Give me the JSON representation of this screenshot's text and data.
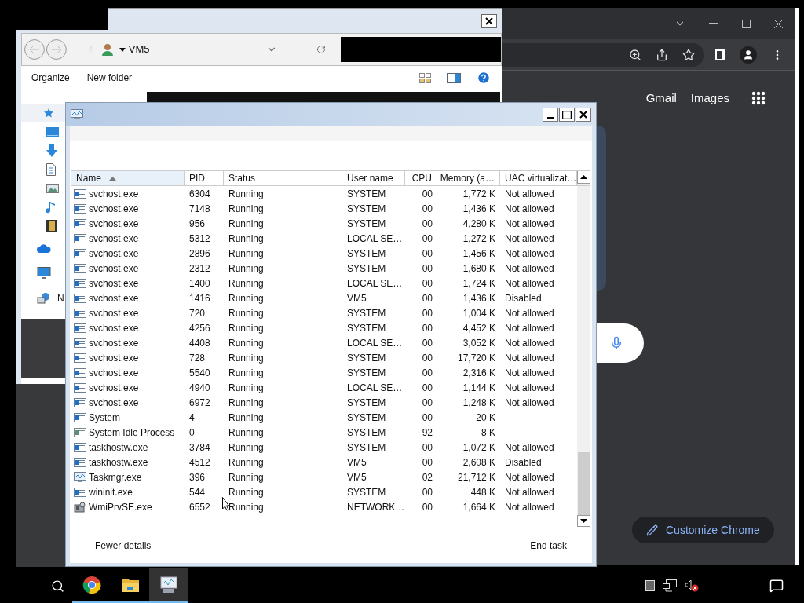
{
  "explorer": {
    "location": "VM5",
    "commands": [
      "Organize",
      "New folder"
    ],
    "nav_items": [
      {
        "kind": "star"
      },
      {
        "kind": "desktop"
      },
      {
        "kind": "download"
      },
      {
        "kind": "document"
      },
      {
        "kind": "pictures"
      },
      {
        "kind": "music"
      },
      {
        "kind": "videos"
      },
      {
        "kind": "cloud"
      },
      {
        "kind": "computer"
      },
      {
        "kind": "network",
        "label": "N"
      }
    ]
  },
  "chrome": {
    "links": [
      "Gmail",
      "Images"
    ],
    "customize_button": "Customize Chrome"
  },
  "task_manager": {
    "columns": [
      {
        "label": "Name",
        "sorted": true
      },
      {
        "label": "PID",
        "sorted": false
      },
      {
        "label": "Status",
        "sorted": false
      },
      {
        "label": "User name",
        "sorted": false
      },
      {
        "label": "CPU",
        "sorted": false
      },
      {
        "label": "Memory (a…",
        "sorted": false
      },
      {
        "label": "UAC virtualizat…",
        "sorted": false
      }
    ],
    "rows": [
      {
        "kind": "service",
        "name": "svchost.exe",
        "pid": "6304",
        "status": "Running",
        "user": "SYSTEM",
        "cpu": "00",
        "memory": "1,772 K",
        "uac": "Not allowed"
      },
      {
        "kind": "service",
        "name": "svchost.exe",
        "pid": "7148",
        "status": "Running",
        "user": "SYSTEM",
        "cpu": "00",
        "memory": "1,436 K",
        "uac": "Not allowed"
      },
      {
        "kind": "service",
        "name": "svchost.exe",
        "pid": "956",
        "status": "Running",
        "user": "SYSTEM",
        "cpu": "00",
        "memory": "4,280 K",
        "uac": "Not allowed"
      },
      {
        "kind": "service",
        "name": "svchost.exe",
        "pid": "5312",
        "status": "Running",
        "user": "LOCAL SE…",
        "cpu": "00",
        "memory": "1,272 K",
        "uac": "Not allowed"
      },
      {
        "kind": "service",
        "name": "svchost.exe",
        "pid": "2896",
        "status": "Running",
        "user": "SYSTEM",
        "cpu": "00",
        "memory": "1,456 K",
        "uac": "Not allowed"
      },
      {
        "kind": "service",
        "name": "svchost.exe",
        "pid": "2312",
        "status": "Running",
        "user": "SYSTEM",
        "cpu": "00",
        "memory": "1,680 K",
        "uac": "Not allowed"
      },
      {
        "kind": "service",
        "name": "svchost.exe",
        "pid": "1400",
        "status": "Running",
        "user": "LOCAL SE…",
        "cpu": "00",
        "memory": "1,724 K",
        "uac": "Not allowed"
      },
      {
        "kind": "service",
        "name": "svchost.exe",
        "pid": "1416",
        "status": "Running",
        "user": "VM5",
        "cpu": "00",
        "memory": "1,436 K",
        "uac": "Disabled"
      },
      {
        "kind": "service",
        "name": "svchost.exe",
        "pid": "720",
        "status": "Running",
        "user": "SYSTEM",
        "cpu": "00",
        "memory": "1,004 K",
        "uac": "Not allowed"
      },
      {
        "kind": "service",
        "name": "svchost.exe",
        "pid": "4256",
        "status": "Running",
        "user": "SYSTEM",
        "cpu": "00",
        "memory": "4,452 K",
        "uac": "Not allowed"
      },
      {
        "kind": "service",
        "name": "svchost.exe",
        "pid": "4408",
        "status": "Running",
        "user": "LOCAL SE…",
        "cpu": "00",
        "memory": "3,052 K",
        "uac": "Not allowed"
      },
      {
        "kind": "service",
        "name": "svchost.exe",
        "pid": "728",
        "status": "Running",
        "user": "SYSTEM",
        "cpu": "00",
        "memory": "17,720 K",
        "uac": "Not allowed"
      },
      {
        "kind": "service",
        "name": "svchost.exe",
        "pid": "5540",
        "status": "Running",
        "user": "SYSTEM",
        "cpu": "00",
        "memory": "2,316 K",
        "uac": "Not allowed"
      },
      {
        "kind": "service",
        "name": "svchost.exe",
        "pid": "4940",
        "status": "Running",
        "user": "LOCAL SE…",
        "cpu": "00",
        "memory": "1,144 K",
        "uac": "Not allowed"
      },
      {
        "kind": "service",
        "name": "svchost.exe",
        "pid": "6972",
        "status": "Running",
        "user": "SYSTEM",
        "cpu": "00",
        "memory": "1,248 K",
        "uac": "Not allowed"
      },
      {
        "kind": "service",
        "name": "System",
        "pid": "4",
        "status": "Running",
        "user": "SYSTEM",
        "cpu": "00",
        "memory": "20 K"
      },
      {
        "kind": "idle",
        "name": "System Idle Process",
        "pid": "0",
        "status": "Running",
        "user": "SYSTEM",
        "cpu": "92",
        "memory": "8 K"
      },
      {
        "kind": "service",
        "name": "taskhostw.exe",
        "pid": "3784",
        "status": "Running",
        "user": "SYSTEM",
        "cpu": "00",
        "memory": "1,072 K",
        "uac": "Not allowed"
      },
      {
        "kind": "service",
        "name": "taskhostw.exe",
        "pid": "4512",
        "status": "Running",
        "user": "VM5",
        "cpu": "00",
        "memory": "2,608 K",
        "uac": "Disabled"
      },
      {
        "kind": "monitor",
        "name": "Taskmgr.exe",
        "pid": "396",
        "status": "Running",
        "user": "VM5",
        "cpu": "02",
        "memory": "21,712 K",
        "uac": "Not allowed"
      },
      {
        "kind": "service",
        "name": "wininit.exe",
        "pid": "544",
        "status": "Running",
        "user": "SYSTEM",
        "cpu": "00",
        "memory": "448 K",
        "uac": "Not allowed"
      },
      {
        "kind": "wmi",
        "name": "WmiPrvSE.exe",
        "pid": "6552",
        "status": "Running",
        "user": "NETWORK…",
        "cpu": "00",
        "memory": "1,664 K",
        "uac": "Not allowed"
      }
    ],
    "footer": [
      "Fewer details",
      "End task"
    ]
  },
  "taskbar": {
    "apps": [
      {
        "kind": "chrome",
        "selected": false
      },
      {
        "kind": "folder",
        "selected": false
      },
      {
        "kind": "monitor",
        "selected": true
      }
    ],
    "tray": [
      {
        "kind": "square"
      },
      {
        "kind": "network"
      },
      {
        "kind": "speaker-muted"
      }
    ]
  }
}
